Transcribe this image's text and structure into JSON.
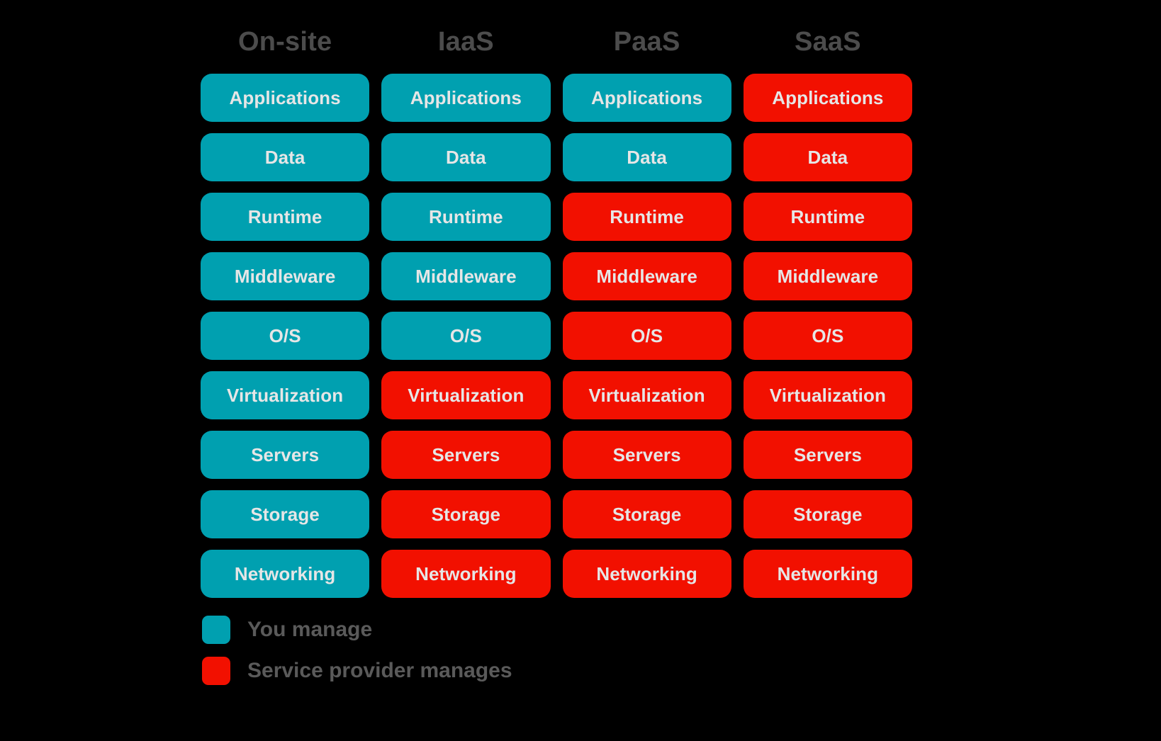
{
  "background_color": "#000000",
  "colors": {
    "you_manage": "#00a0b0",
    "provider_manages": "#f21000",
    "header_text": "#4c4c4c",
    "cell_text": "#e6e6e6",
    "legend_text": "#5a5a5a"
  },
  "columns": [
    {
      "label": "On-site"
    },
    {
      "label": "IaaS"
    },
    {
      "label": "PaaS"
    },
    {
      "label": "SaaS"
    }
  ],
  "rows": [
    {
      "layer": "Applications",
      "cells": [
        {
          "label": "Applications",
          "owner": "you"
        },
        {
          "label": "Applications",
          "owner": "you"
        },
        {
          "label": "Applications",
          "owner": "you"
        },
        {
          "label": "Applications",
          "owner": "provider"
        }
      ]
    },
    {
      "layer": "Data",
      "cells": [
        {
          "label": "Data",
          "owner": "you"
        },
        {
          "label": "Data",
          "owner": "you"
        },
        {
          "label": "Data",
          "owner": "you"
        },
        {
          "label": "Data",
          "owner": "provider"
        }
      ]
    },
    {
      "layer": "Runtime",
      "cells": [
        {
          "label": "Runtime",
          "owner": "you"
        },
        {
          "label": "Runtime",
          "owner": "you"
        },
        {
          "label": "Runtime",
          "owner": "provider"
        },
        {
          "label": "Runtime",
          "owner": "provider"
        }
      ]
    },
    {
      "layer": "Middleware",
      "cells": [
        {
          "label": "Middleware",
          "owner": "you"
        },
        {
          "label": "Middleware",
          "owner": "you"
        },
        {
          "label": "Middleware",
          "owner": "provider"
        },
        {
          "label": "Middleware",
          "owner": "provider"
        }
      ]
    },
    {
      "layer": "O/S",
      "cells": [
        {
          "label": "O/S",
          "owner": "you"
        },
        {
          "label": "O/S",
          "owner": "you"
        },
        {
          "label": "O/S",
          "owner": "provider"
        },
        {
          "label": "O/S",
          "owner": "provider"
        }
      ]
    },
    {
      "layer": "Virtualization",
      "cells": [
        {
          "label": "Virtualization",
          "owner": "you"
        },
        {
          "label": "Virtualization",
          "owner": "provider"
        },
        {
          "label": "Virtualization",
          "owner": "provider"
        },
        {
          "label": "Virtualization",
          "owner": "provider"
        }
      ]
    },
    {
      "layer": "Servers",
      "cells": [
        {
          "label": "Servers",
          "owner": "you"
        },
        {
          "label": "Servers",
          "owner": "provider"
        },
        {
          "label": "Servers",
          "owner": "provider"
        },
        {
          "label": "Servers",
          "owner": "provider"
        }
      ]
    },
    {
      "layer": "Storage",
      "cells": [
        {
          "label": "Storage",
          "owner": "you"
        },
        {
          "label": "Storage",
          "owner": "provider"
        },
        {
          "label": "Storage",
          "owner": "provider"
        },
        {
          "label": "Storage",
          "owner": "provider"
        }
      ]
    },
    {
      "layer": "Networking",
      "cells": [
        {
          "label": "Networking",
          "owner": "you"
        },
        {
          "label": "Networking",
          "owner": "provider"
        },
        {
          "label": "Networking",
          "owner": "provider"
        },
        {
          "label": "Networking",
          "owner": "provider"
        }
      ]
    }
  ],
  "legend": [
    {
      "label": "You manage",
      "owner": "you"
    },
    {
      "label": "Service provider manages",
      "owner": "provider"
    }
  ]
}
